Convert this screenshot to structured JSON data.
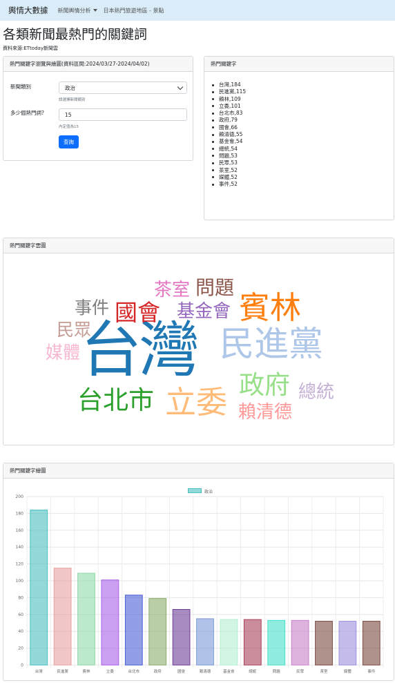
{
  "navbar": {
    "brand": "輿情大數據",
    "links": [
      "新聞輿情分析",
      "日本熱門旅遊地區 - 景點"
    ]
  },
  "page_title": "各類新聞最熱門的關鍵詞",
  "source": "資料來源:ETtoday新聞雲",
  "query_card": {
    "header": "熱門關鍵字瀏覽與繪圖(資料區間:2024/03/27-2024/04/02)",
    "category_label": "新聞類別",
    "category_value": "政治",
    "category_help": "請選擇新聞類別",
    "topk_label": "多少個熱門詞?",
    "topk_value": "15",
    "topk_help": "內定值為15",
    "submit_label": "查詢"
  },
  "keywords_card": {
    "header": "熱門關鍵字",
    "items": [
      "台灣,184",
      "民進黨,115",
      "賴林,109",
      "立委,101",
      "台北市,83",
      "政府,79",
      "國會,66",
      "賴清德,55",
      "基金會,54",
      "總統,54",
      "問題,53",
      "民眾,53",
      "茶室,52",
      "媒體,52",
      "事件,52"
    ]
  },
  "wordcloud_card": {
    "header": "熱門關鍵字雲圖",
    "words": [
      {
        "text": "台灣",
        "color": "#1f77b4"
      },
      {
        "text": "民進黨",
        "color": "#aec7e8"
      },
      {
        "text": "賓林",
        "color": "#ff7f0e"
      },
      {
        "text": "立委",
        "color": "#ffbb78"
      },
      {
        "text": "台北市",
        "color": "#2ca02c"
      },
      {
        "text": "政府",
        "color": "#98df8a"
      },
      {
        "text": "國會",
        "color": "#d62728"
      },
      {
        "text": "賴清德",
        "color": "#ff9896"
      },
      {
        "text": "基金會",
        "color": "#9467bd"
      },
      {
        "text": "總統",
        "color": "#c5b0d5"
      },
      {
        "text": "問題",
        "color": "#8c564b"
      },
      {
        "text": "民眾",
        "color": "#c49c94"
      },
      {
        "text": "茶室",
        "color": "#e377c2"
      },
      {
        "text": "媒體",
        "color": "#f7b6d2"
      },
      {
        "text": "事件",
        "color": "#7f7f7f"
      }
    ]
  },
  "bar_card": {
    "header": "熱門關鍵字繪圖",
    "legend": "政治"
  },
  "chart_data": {
    "type": "bar",
    "categories": [
      "台灣",
      "民進黨",
      "賓林",
      "立委",
      "台北市",
      "政府",
      "國會",
      "賴清德",
      "基金會",
      "總統",
      "問題",
      "民眾",
      "茶室",
      "媒體",
      "事件"
    ],
    "series": [
      {
        "name": "政治",
        "values": [
          184,
          115,
          109,
          101,
          83,
          79,
          66,
          55,
          54,
          54,
          53,
          53,
          52,
          52,
          52
        ]
      }
    ],
    "ylim": [
      0,
      200
    ],
    "yticks": [
      0,
      20,
      40,
      60,
      80,
      100,
      120,
      140,
      160,
      180,
      200
    ],
    "colors": [
      "#4bc0c0",
      "#e8a0a0",
      "#90d8a8",
      "#a861ea",
      "#4a5ed6",
      "#8aad6a",
      "#6e3d98",
      "#7c9ad8",
      "#b3f0d0",
      "#a84058",
      "#44e0c8",
      "#c880c8",
      "#7a4a40",
      "#a090e0",
      "#7a4a40"
    ],
    "grid": true,
    "legend_position": "top"
  }
}
